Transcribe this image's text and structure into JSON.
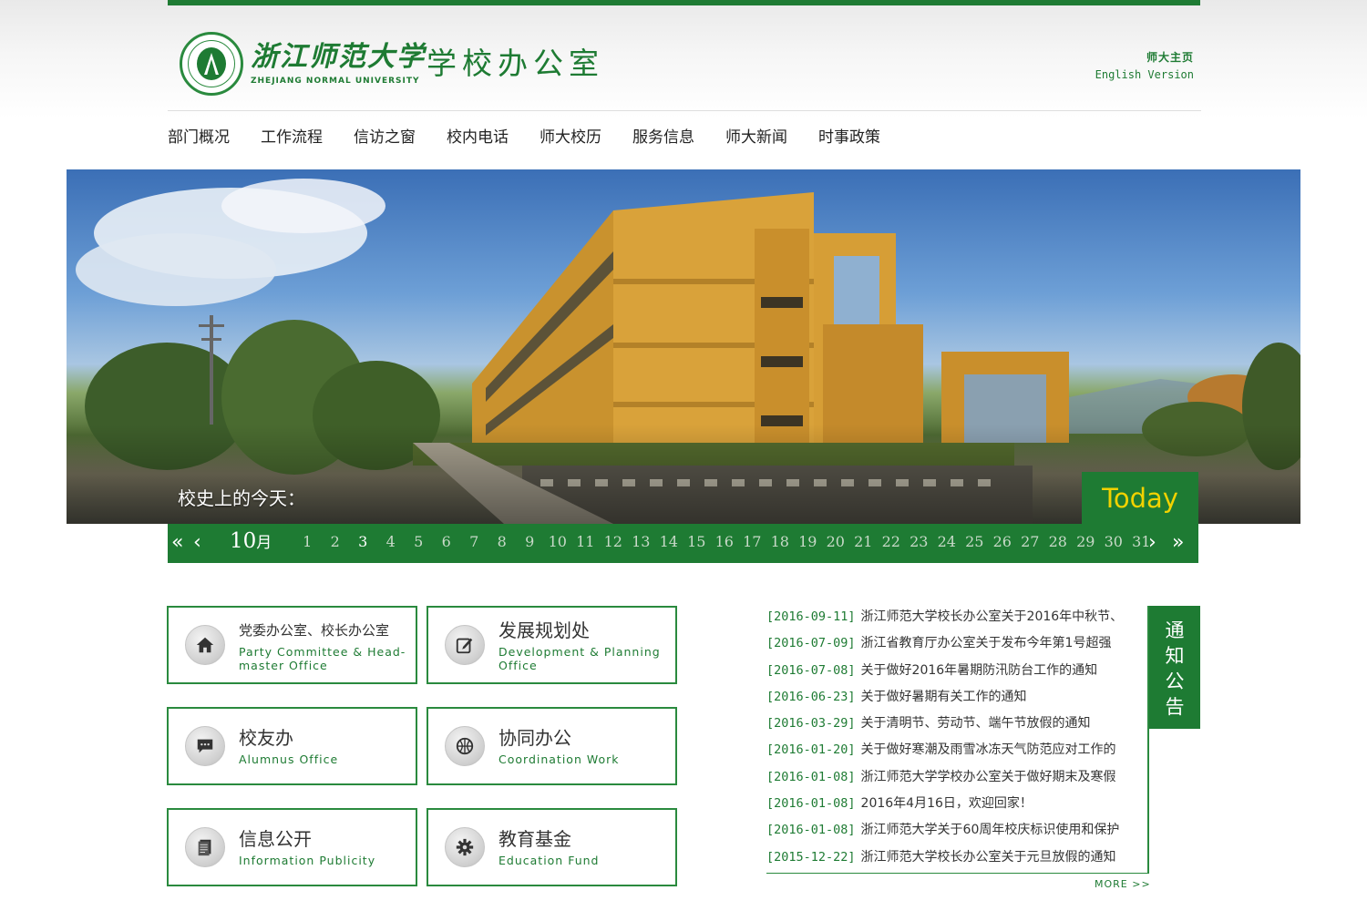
{
  "header": {
    "school_name_cn": "浙江师范大学",
    "school_name_en": "ZHEJIANG NORMAL UNIVERSITY",
    "office_title": "学校办公室",
    "links": {
      "home": "师大主页",
      "english": "English Version"
    }
  },
  "nav": {
    "items": [
      "部门概况",
      "工作流程",
      "信访之窗",
      "校内电话",
      "师大校历",
      "服务信息",
      "师大新闻",
      "时事政策"
    ]
  },
  "banner": {
    "history_label": "校史上的今天：",
    "today_label": "Today"
  },
  "calendar": {
    "month_number": "10",
    "month_suffix": "月",
    "active_day": "3",
    "days": [
      "1",
      "2",
      "3",
      "4",
      "5",
      "6",
      "7",
      "8",
      "9",
      "10",
      "11",
      "12",
      "13",
      "14",
      "15",
      "16",
      "17",
      "18",
      "19",
      "20",
      "21",
      "22",
      "23",
      "24",
      "25",
      "26",
      "27",
      "28",
      "29",
      "30",
      "31"
    ]
  },
  "departments": [
    {
      "cn": "党委办公室、校长办公室",
      "en": "Party Committee & Head-master Office",
      "icon": "home-icon"
    },
    {
      "cn": "发展规划处",
      "en": "Development & Planning Office",
      "icon": "edit-icon"
    },
    {
      "cn": "校友办",
      "en": "Alumnus Office",
      "icon": "chat-icon"
    },
    {
      "cn": "协同办公",
      "en": "Coordination Work",
      "icon": "basketball-icon"
    },
    {
      "cn": "信息公开",
      "en": "Information Publicity",
      "icon": "document-icon"
    },
    {
      "cn": "教育基金",
      "en": "Education Fund",
      "icon": "gear-icon"
    }
  ],
  "notices": {
    "tab_label": "通知公告",
    "more": "MORE >>",
    "items": [
      {
        "date": "[2016-09-11]",
        "title": "浙江师范大学校长办公室关于2016年中秋节、"
      },
      {
        "date": "[2016-07-09]",
        "title": "浙江省教育厅办公室关于发布今年第1号超强"
      },
      {
        "date": "[2016-07-08]",
        "title": "关于做好2016年暑期防汛防台工作的通知"
      },
      {
        "date": "[2016-06-23]",
        "title": "关于做好暑期有关工作的通知"
      },
      {
        "date": "[2016-03-29]",
        "title": "关于清明节、劳动节、端午节放假的通知"
      },
      {
        "date": "[2016-01-20]",
        "title": "关于做好寒潮及雨雪冰冻天气防范应对工作的"
      },
      {
        "date": "[2016-01-08]",
        "title": "浙江师范大学学校办公室关于做好期末及寒假"
      },
      {
        "date": "[2016-01-08]",
        "title": "2016年4月16日，欢迎回家！"
      },
      {
        "date": "[2016-01-08]",
        "title": "浙江师范大学关于60周年校庆标识使用和保护"
      },
      {
        "date": "[2015-12-22]",
        "title": "浙江师范大学校长办公室关于元旦放假的通知"
      }
    ]
  },
  "colors": {
    "brand_green": "#1e7b33",
    "today_yellow": "#f2d200"
  }
}
